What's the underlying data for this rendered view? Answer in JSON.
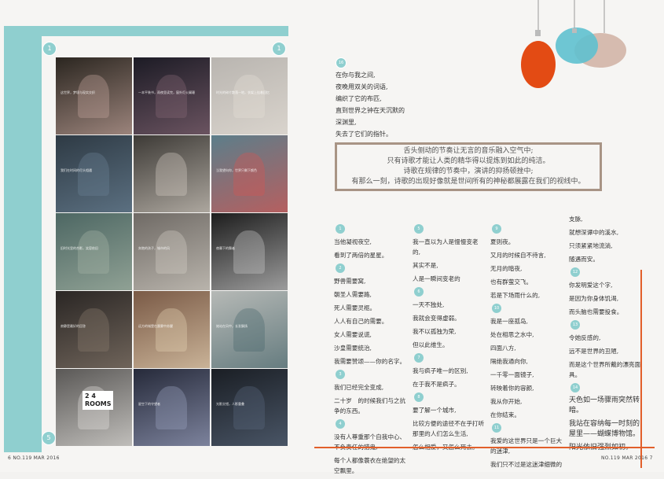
{
  "left_page": {
    "circle_top_left": "1",
    "circle_top_right": "1",
    "circle_bottom": "5",
    "footer": "6  NO.119 MAR 2016"
  },
  "tiles": [
    {
      "bg": "#2b2620",
      "accent": "#c8a9a0",
      "caption": "这世界，梦境与现实交织"
    },
    {
      "bg": "#1c1b25",
      "accent": "#8a6a78",
      "caption": "一本平装书，雨夜里读完，窗外灯火阑珊"
    },
    {
      "bg": "#b9b5b0",
      "accent": "#e6e0d8",
      "caption": "时光的碎片散落一地，衣架上挂着回忆"
    },
    {
      "bg": "#2e3a44",
      "accent": "#6d8599",
      "caption": "我们在时间的尽头相遇"
    },
    {
      "bg": "#3d3a36",
      "accent": "#d9d2c8",
      "caption": ""
    },
    {
      "bg": "#5c7e8a",
      "accent": "#d9534f",
      "caption": "当我望向你，世界只剩下颜色"
    },
    {
      "bg": "#4d6763",
      "accent": "#aab8a8",
      "caption": "旧时光里的合影，笑容依旧"
    },
    {
      "bg": "#6f6a65",
      "accent": "#d6d1c8",
      "caption": "奔跑的孩子，城市的风"
    },
    {
      "bg": "#1d1d1d",
      "accent": "#cfcfcf",
      "caption": "夜幕下的舞者"
    },
    {
      "bg": "#2a2624",
      "accent": "#8b7d70",
      "caption": "寂静是最好的回答"
    },
    {
      "bg": "#7a5a46",
      "accent": "#e9d6b8",
      "caption": "远方的城堡在晨雾中苏醒"
    },
    {
      "bg": "#b6b9b6",
      "accent": "#46646a",
      "caption": "她站在风中，长发飘扬"
    },
    {
      "bg": "#5a5856",
      "accent": "#e8e6e2",
      "caption": ""
    },
    {
      "bg": "#262a3a",
      "accent": "#9fa6c4",
      "caption": "星空下的守望者"
    },
    {
      "bg": "#1a1e24",
      "accent": "#5c6b80",
      "caption": "光影交错，人影重叠"
    }
  ],
  "tile_words": {
    "t13_line1": "2  4",
    "t13_line2": "ROOMS"
  },
  "right_page": {
    "poem_num": "16",
    "poem_lines": [
      "在你与我之间,",
      "夜晚用双关的词语,",
      "编织了它的布匹,",
      "直到世界之钟在天沉默的",
      "深渊里,",
      "失去了它们的指针。"
    ],
    "quote_lines": [
      "舌头侧动的节奏让无言的音乐融入空气中;",
      "只有诗歌才能让人类的精华得以提炼到如此的纯洁。",
      "诗歌在规律的节奏中，演讲的抑扬顿挫中;",
      "有那么一刻，诗歌的出现好像就是世间所有的神秘都展露在我们的视线中。"
    ],
    "col1": [
      {
        "n": "1",
        "lines": [
          "当他凝视夜空,",
          "看到了两倍的星星。"
        ]
      },
      {
        "n": "2",
        "lines": [
          "野兽需要窝,",
          "朝圣人需要路,",
          "死人需要灵柩。",
          "人人有自己的需要。",
          "女人需要说谎,",
          "沙皇需要统治,",
          "我需要赞颂——你的名字。"
        ]
      },
      {
        "n": "3",
        "lines": [
          "我们已经完全变成,",
          "二十岁　的时候我们与之抗争的东西。"
        ]
      },
      {
        "n": "4",
        "lines": [
          "没有人尊重那个自我中心、不负责任的猎鬼,",
          "每个人都像蓑衣在绝望的太空飘里。"
        ]
      }
    ],
    "col2": [
      {
        "n": "5",
        "lines": [
          "我一直以为人是慢慢变老的,",
          "其实不是,",
          "人是一瞬间变老的"
        ]
      },
      {
        "n": "6",
        "lines": [
          "一天不独处,",
          "我就会变得虚弱。",
          "我不以孤独为荣,",
          "但以此维生。"
        ]
      },
      {
        "n": "7",
        "lines": [
          "我与疯子唯一的区别,",
          "在于我不是疯子。"
        ]
      },
      {
        "n": "8",
        "lines": [
          "要了解一个城市,",
          "比较方便的途径不在乎打听那里的人们怎么生活,",
          "怎么相爱，又怎么死去。"
        ]
      }
    ],
    "col3": [
      {
        "n": "9",
        "lines": [
          "夏则夜。",
          "又月的时候自不待言,",
          "无月的暗夜,",
          "也有群萤交飞。",
          "若是下场雨什么的,"
        ]
      },
      {
        "n": "10",
        "lines": [
          "我是一座孤岛,",
          "处在相思之水中,",
          "四面八方,",
          "隔绝我通向你,",
          "一千零一面镜子,",
          "转映着你的容颜,",
          "我从你开始,",
          "在你结束。"
        ]
      },
      {
        "n": "11",
        "lines": [
          "我爱的这世界只是一个巨大的迷津,",
          "我们只不过是这迷津细微的"
        ]
      }
    ],
    "col4": [
      {
        "n": "",
        "lines": [
          "支脉,",
          "就想深谭中的溪水,",
          "只须紧紧地流淌,",
          "随遇而安。"
        ]
      },
      {
        "n": "12",
        "lines": [
          "你发明爱这个字,",
          "是因为你身体饥渴,",
          "而头脑也需要投食。"
        ]
      },
      {
        "n": "13",
        "lines": [
          "令她反感的,",
          "远不是世界的丑陋,",
          "而是这个世界所戴的漂亮面具。"
        ]
      },
      {
        "n": "14",
        "lines": [
          "天色如一场骤雨突然转暗。",
          "我站在容纳每一时刻的屋里——蝴蝶博物馆。",
          "阳光依旧强烈如初。"
        ]
      }
    ],
    "footer": "NO.119 MAR 2016",
    "page_num": "7"
  }
}
